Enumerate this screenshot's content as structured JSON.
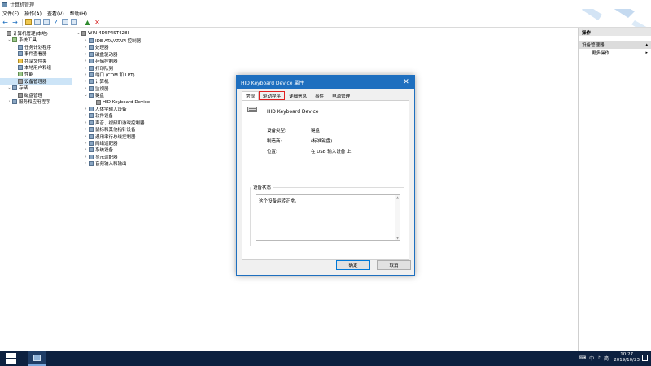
{
  "window": {
    "title": "计算机管理"
  },
  "menu": [
    "文件(F)",
    "操作(A)",
    "查看(V)",
    "帮助(H)"
  ],
  "toolbar": {
    "buttons": [
      "back-arrow-icon",
      "forward-arrow-icon",
      "up-folder-icon",
      "show-hide-tree-icon",
      "properties-icon",
      "help-icon",
      "console-icon",
      "monitor-icon",
      "update-driver-icon",
      "uninstall-icon"
    ]
  },
  "left_tree": [
    {
      "label": "计算机管理(本地)",
      "depth": 0,
      "arrow": "",
      "icon": "computer-management-icon"
    },
    {
      "label": "系统工具",
      "depth": 1,
      "arrow": "⌄",
      "icon": "tools-icon"
    },
    {
      "label": "任务计划程序",
      "depth": 2,
      "arrow": "›",
      "icon": "task-scheduler-icon"
    },
    {
      "label": "事件查看器",
      "depth": 2,
      "arrow": "›",
      "icon": "event-viewer-icon"
    },
    {
      "label": "共享文件夹",
      "depth": 2,
      "arrow": "›",
      "icon": "shared-folder-icon"
    },
    {
      "label": "本地用户和组",
      "depth": 2,
      "arrow": "›",
      "icon": "users-icon"
    },
    {
      "label": "性能",
      "depth": 2,
      "arrow": "›",
      "icon": "performance-icon"
    },
    {
      "label": "设备管理器",
      "depth": 2,
      "arrow": "",
      "icon": "device-manager-icon",
      "selected": true
    },
    {
      "label": "存储",
      "depth": 1,
      "arrow": "⌄",
      "icon": "storage-icon"
    },
    {
      "label": "磁盘管理",
      "depth": 2,
      "arrow": "",
      "icon": "disk-icon"
    },
    {
      "label": "服务和应用程序",
      "depth": 1,
      "arrow": "›",
      "icon": "services-icon"
    }
  ],
  "device_tree": {
    "root": "WIN-4D5P4ST428I",
    "items": [
      {
        "label": "IDE ATA/ATAPI 控制器",
        "arrow": "›",
        "depth": 1
      },
      {
        "label": "处理器",
        "arrow": "›",
        "depth": 1
      },
      {
        "label": "磁盘驱动器",
        "arrow": "›",
        "depth": 1
      },
      {
        "label": "存储控制器",
        "arrow": "›",
        "depth": 1
      },
      {
        "label": "打印队列",
        "arrow": "›",
        "depth": 1
      },
      {
        "label": "端口 (COM 和 LPT)",
        "arrow": "›",
        "depth": 1
      },
      {
        "label": "计算机",
        "arrow": "›",
        "depth": 1
      },
      {
        "label": "监视器",
        "arrow": "›",
        "depth": 1
      },
      {
        "label": "键盘",
        "arrow": "⌄",
        "depth": 1
      },
      {
        "label": "HID Keyboard Device",
        "arrow": "",
        "depth": 2
      },
      {
        "label": "人体学输入设备",
        "arrow": "›",
        "depth": 1
      },
      {
        "label": "软件设备",
        "arrow": "›",
        "depth": 1
      },
      {
        "label": "声音、视频和游戏控制器",
        "arrow": "›",
        "depth": 1
      },
      {
        "label": "鼠标和其他指针设备",
        "arrow": "›",
        "depth": 1
      },
      {
        "label": "通用串行总线控制器",
        "arrow": "›",
        "depth": 1
      },
      {
        "label": "网络适配器",
        "arrow": "›",
        "depth": 1
      },
      {
        "label": "系统设备",
        "arrow": "›",
        "depth": 1
      },
      {
        "label": "显示适配器",
        "arrow": "›",
        "depth": 1
      },
      {
        "label": "音频输入和输出",
        "arrow": "›",
        "depth": 1
      }
    ]
  },
  "actions_pane": {
    "header": "操作",
    "section": "设备管理器",
    "more": "更多操作"
  },
  "dialog": {
    "title": "HID Keyboard Device 属性",
    "tabs": [
      "常规",
      "驱动程序",
      "详细信息",
      "事件",
      "电源管理"
    ],
    "device_name": "HID Keyboard Device",
    "props": [
      {
        "label": "设备类型:",
        "value": "键盘"
      },
      {
        "label": "制造商:",
        "value": "(标准键盘)"
      },
      {
        "label": "位置:",
        "value": "在 USB 输入设备 上"
      }
    ],
    "status_label": "设备状态",
    "status_text": "这个设备运转正常。",
    "ok": "确定",
    "cancel": "取消"
  },
  "taskbar": {
    "tray": [
      "中",
      "♪",
      "简"
    ],
    "time": "10:27",
    "date": "2019/10/23"
  },
  "colors": {
    "accent": "#1e6fbf",
    "highlight": "#e02020",
    "taskbar": "#0d2140"
  }
}
